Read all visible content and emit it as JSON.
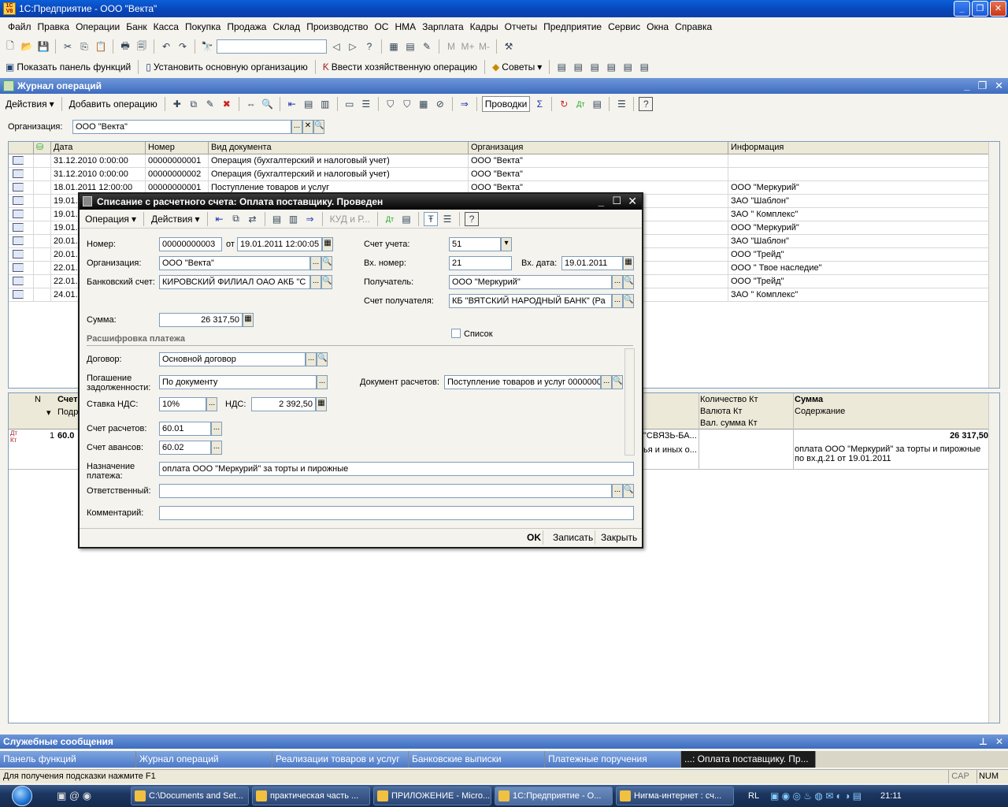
{
  "app": {
    "title": "1С:Предприятие - ООО \"Векта\""
  },
  "menu": [
    "Файл",
    "Правка",
    "Операции",
    "Банк",
    "Касса",
    "Покупка",
    "Продажа",
    "Склад",
    "Производство",
    "ОС",
    "НМА",
    "Зарплата",
    "Кадры",
    "Отчеты",
    "Предприятие",
    "Сервис",
    "Окна",
    "Справка"
  ],
  "toolbar2": {
    "panel": "Показать панель функций",
    "org": "Установить основную организацию",
    "op": "Ввести хозяйственную операцию",
    "tips": "Советы"
  },
  "journal": {
    "title": "Журнал операций",
    "actions": "Действия",
    "add": "Добавить операцию",
    "postings": "Проводки",
    "org_label": "Организация:",
    "org_value": "ООО \"Векта\"",
    "columns": [
      "Дата",
      "Номер",
      "Вид документа",
      "Организация",
      "Информация"
    ],
    "rows": [
      [
        "31.12.2010 0:00:00",
        "00000000001",
        "Операция (бухгалтерский и налоговый учет)",
        "ООО \"Векта\"",
        ""
      ],
      [
        "31.12.2010 0:00:00",
        "00000000002",
        "Операция (бухгалтерский и налоговый учет)",
        "ООО \"Векта\"",
        ""
      ],
      [
        "18.01.2011 12:00:00",
        "00000000001",
        "Поступление товаров и услуг",
        "ООО \"Векта\"",
        "ООО \"Меркурий\""
      ],
      [
        "19.01.",
        "",
        "",
        "",
        "ЗАО \"Шаблон\""
      ],
      [
        "19.01.",
        "",
        "",
        "",
        "ЗАО \" Комплекс\""
      ],
      [
        "19.01.",
        "",
        "",
        "",
        "ООО \"Меркурий\""
      ],
      [
        "20.01.",
        "",
        "",
        "",
        "ЗАО \"Шаблон\""
      ],
      [
        "20.01.",
        "",
        "",
        "",
        "ООО \"Трейд\""
      ],
      [
        "22.01.",
        "",
        "",
        "",
        "ООО \" Твое наследие\""
      ],
      [
        "22.01.",
        "",
        "",
        "",
        "ООО \"Трейд\""
      ],
      [
        "24.01.",
        "",
        "",
        "",
        "ЗАО \" Комплекс\""
      ]
    ]
  },
  "postings": {
    "h_n": "N",
    "h_account": "Счет",
    "h_sub": "Подр",
    "h_qty": "Количество Кт",
    "h_cur": "Валюта Кт",
    "h_cursum": "Вал. сумма Кт",
    "h_sum": "Сумма",
    "h_content": "Содержание",
    "row_n": "1",
    "row_acc": "60.0",
    "row_mid1": "\"СВЯЗЬ-БА...",
    "row_mid2": "ья и иных о...",
    "row_sum": "26 317,50",
    "row_text": "оплата ООО \"Меркурий\" за торты и пирожные по вх.д.21 от 19.01.2011"
  },
  "dialog": {
    "title": "Списание с расчетного счета: Оплата поставщику. Проведен",
    "menu_op": "Операция",
    "menu_act": "Действия",
    "kud": "КУД и Р...",
    "l_num": "Номер:",
    "v_num": "00000000003",
    "l_from": "от",
    "v_date": "19.01.2011 12:00:05",
    "l_org": "Организация:",
    "v_org": "ООО \"Векта\"",
    "l_bank": "Банковский счет:",
    "v_bank": "КИРОВСКИЙ ФИЛИАЛ ОАО АКБ \"С",
    "l_sum": "Сумма:",
    "v_sum": "26 317,50",
    "l_acc": "Счет учета:",
    "v_acc": "51",
    "l_innum": "Вх. номер:",
    "v_innum": "21",
    "l_indate": "Вх. дата:",
    "v_indate": "19.01.2011",
    "l_recv": "Получатель:",
    "v_recv": "ООО \"Меркурий\"",
    "l_recvacc": "Счет получателя:",
    "v_recvacc": "КБ \"ВЯТСКИЙ НАРОДНЫЙ БАНК\" (Ра",
    "section": "Расшифровка платежа",
    "list": "Список",
    "l_contract": "Договор:",
    "v_contract": "Основной договор",
    "l_repay1": "Погашение",
    "l_repay2": "задолженности:",
    "v_repay": "По документу",
    "l_docset": "Документ расчетов:",
    "v_docset": "Поступление товаров и услуг 0000000",
    "l_vat": "Ставка НДС:",
    "v_vat": "10%",
    "l_nds": "НДС:",
    "v_nds": "2 392,50",
    "l_calc": "Счет расчетов:",
    "v_calc": "60.01",
    "l_adv": "Счет авансов:",
    "v_adv": "60.02",
    "l_purpose1": "Назначение",
    "l_purpose2": "платежа:",
    "v_purpose": "оплата ООО \"Меркурий\" за торты и пирожные",
    "l_resp": "Ответственный:",
    "l_comment": "Комментарий:",
    "ok": "OK",
    "save": "Записать",
    "close": "Закрыть"
  },
  "service_messages": "Служебные сообщения",
  "window_tabs": [
    "Панель функций",
    "Журнал операций",
    "Реализации товаров и услуг",
    "Банковские выписки",
    "Платежные поручения",
    "...: Оплата поставщику. Пр..."
  ],
  "status": "Для получения подсказки нажмите F1",
  "status_cap": "CAP",
  "status_num": "NUM",
  "taskbar": {
    "items": [
      "C:\\Documents and Set...",
      "практическая часть ...",
      "ПРИЛОЖЕНИЕ - Micro...",
      "1С:Предприятие - О...",
      "Нигма-интернет : сч..."
    ],
    "lang": "RL",
    "time": "21:11"
  }
}
